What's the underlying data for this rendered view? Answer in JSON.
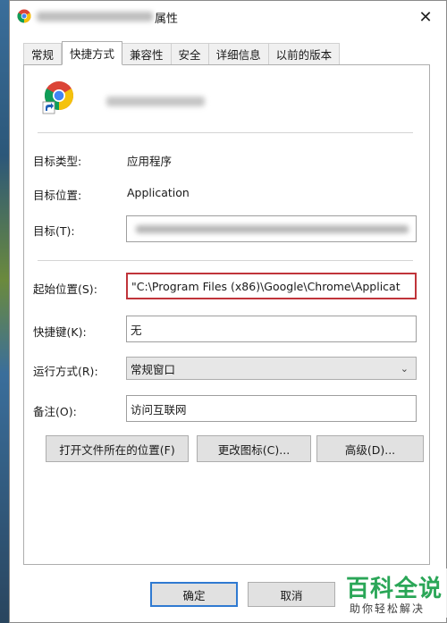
{
  "window": {
    "title_suffix": "属性",
    "close_glyph": "✕"
  },
  "tabs": [
    {
      "label": "常规"
    },
    {
      "label": "快捷方式",
      "active": true
    },
    {
      "label": "兼容性"
    },
    {
      "label": "安全"
    },
    {
      "label": "详细信息"
    },
    {
      "label": "以前的版本"
    }
  ],
  "shortcut": {
    "target_type_label": "目标类型:",
    "target_type_value": "应用程序",
    "target_location_label": "目标位置:",
    "target_location_value": "Application",
    "target_label": "目标(T):",
    "start_in_label": "起始位置(S):",
    "start_in_value": "\"C:\\Program Files (x86)\\Google\\Chrome\\Applicat",
    "hotkey_label": "快捷键(K):",
    "hotkey_value": "无",
    "run_label": "运行方式(R):",
    "run_value": "常规窗口",
    "comment_label": "备注(O):",
    "comment_value": "访问互联网",
    "open_location_button": "打开文件所在的位置(F)",
    "change_icon_button": "更改图标(C)...",
    "advanced_button": "高级(D)..."
  },
  "footer": {
    "ok_button": "确定",
    "cancel_button": "取消"
  },
  "watermark": {
    "title": "百科全说",
    "subtitle": "助你轻松解决"
  },
  "icons": {
    "app": "chrome-icon",
    "shortcut_overlay": "shortcut-arrow-icon",
    "dropdown": "chevron-down-icon"
  },
  "colors": {
    "focus_border": "#c0343a",
    "primary_button_border": "#2f7ad1",
    "watermark_green": "#2aa657"
  }
}
